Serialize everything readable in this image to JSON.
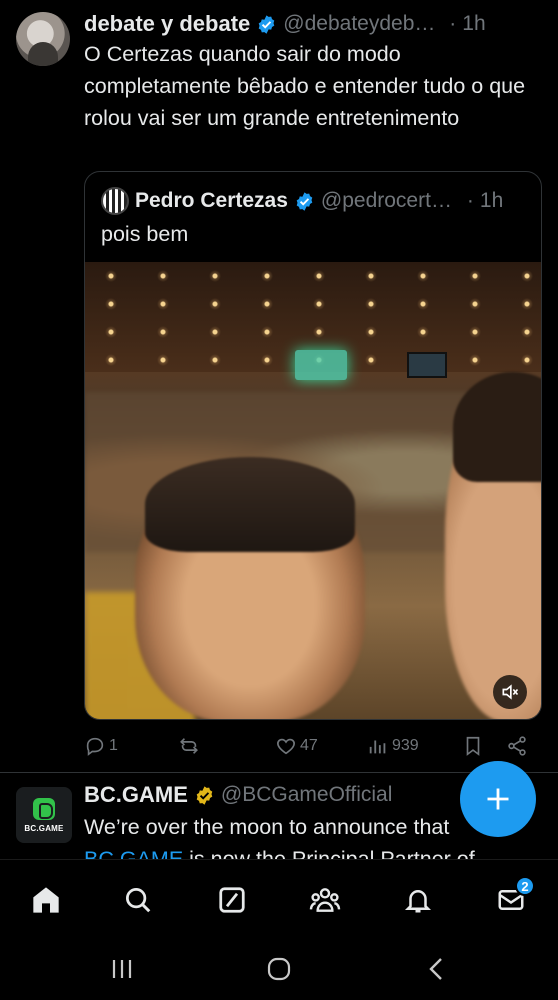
{
  "tweet": {
    "author_name": "debate y debate",
    "author_handle": "@debateydebate",
    "time": "1h",
    "text": "O Certezas quando sair do modo completamente bêbado e entender tudo o que rolou vai ser um grande entretenimento",
    "quote": {
      "author_name": "Pedro Certezas",
      "author_handle": "@pedrocertezas",
      "time": "1h",
      "text": "pois bem"
    },
    "actions": {
      "replies": "1",
      "retweets": "",
      "likes": "47",
      "views": "939"
    }
  },
  "next_tweet": {
    "author_name": "BC.GAME",
    "author_handle": "@BCGameOfficial",
    "avatar_text": "BC.GAME",
    "text_line1": "We’re over the moon to announce that",
    "text_line2_link": "BC.GAME",
    "text_line2_rest": " is now the Principal Partner of"
  },
  "nav": {
    "message_badge": "2"
  },
  "icons": {
    "verified_blue": "#1d9bf0",
    "verified_gold": "#e2b719",
    "accent": "#1d9bf0"
  }
}
